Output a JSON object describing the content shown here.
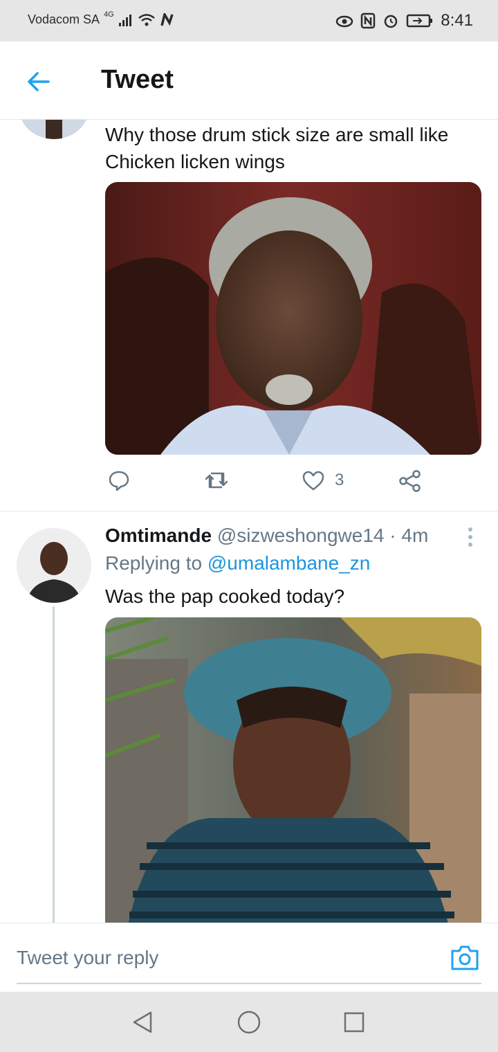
{
  "status_bar": {
    "carrier": "Vodacom SA",
    "network": "4G",
    "time": "8:41"
  },
  "header": {
    "title": "Tweet"
  },
  "tweet1": {
    "text_line1": "Why those drum stick size are small like",
    "text_line2": "Chicken licken wings",
    "like_count": "3"
  },
  "tweet2": {
    "display_name": "Omtimande",
    "handle": "@sizweshongwe14",
    "separator": "·",
    "time": "4m",
    "replying_prefix": "Replying to",
    "replying_mention": "@umalambane_zn",
    "text": "Was the pap cooked today?"
  },
  "reply_bar": {
    "placeholder": "Tweet your reply"
  },
  "colors": {
    "accent": "#1da1f2",
    "mention": "#1b95e0",
    "secondary_text": "#657786",
    "divider": "#e1e8ed"
  },
  "icons": {
    "back": "arrow-left-icon",
    "reply": "comment-icon",
    "retweet": "retweet-icon",
    "like": "heart-icon",
    "share": "share-icon",
    "more": "vertical-dots-icon",
    "camera": "camera-icon"
  }
}
